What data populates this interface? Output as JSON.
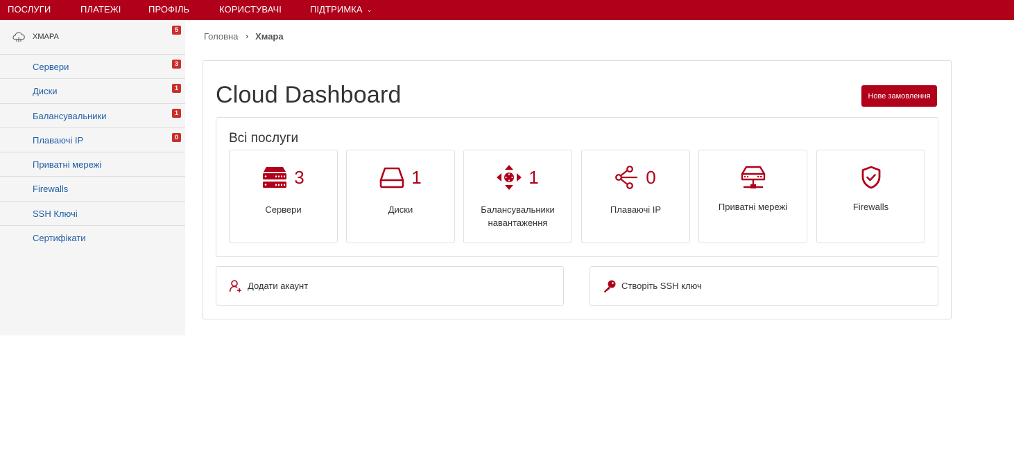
{
  "topnav": {
    "items": [
      {
        "label": "Послуги"
      },
      {
        "label": "Платежі"
      },
      {
        "label": "Профіль"
      },
      {
        "label": "Користувачі"
      },
      {
        "label": "Підтримка"
      }
    ]
  },
  "sidebar": {
    "header": {
      "label": "ХМАРА",
      "badge": "5",
      "icon": "cloud-icon"
    },
    "items": [
      {
        "label": "Сервери",
        "badge": "3"
      },
      {
        "label": "Диски",
        "badge": "1"
      },
      {
        "label": "Балансувальники",
        "badge": "1"
      },
      {
        "label": "Плаваючі IP",
        "badge": "0"
      },
      {
        "label": "Приватні мережі"
      },
      {
        "label": "Firewalls"
      },
      {
        "label": "SSH Ключі"
      },
      {
        "label": "Сертифікати"
      }
    ]
  },
  "breadcrumb": {
    "home": "Головна",
    "current": "Хмара"
  },
  "main": {
    "title": "Cloud Dashboard",
    "new_order_label": "Нове замовлення",
    "services_title": "Всі послуги",
    "tiles": [
      {
        "label": "Сервери",
        "count": "3",
        "icon": "server-icon"
      },
      {
        "label": "Диски",
        "count": "1",
        "icon": "disk-icon"
      },
      {
        "label": "Балансувальники навантаження",
        "count": "1",
        "icon": "load-balancer-icon"
      },
      {
        "label": "Плаваючі IP",
        "count": "0",
        "icon": "floating-ip-icon"
      },
      {
        "label": "Приватні мережі",
        "icon": "private-network-icon"
      },
      {
        "label": "Firewalls",
        "icon": "shield-icon"
      }
    ],
    "actions": [
      {
        "label": "Додати акаунт",
        "icon": "add-user-icon"
      },
      {
        "label": "Створіть SSH ключ",
        "icon": "key-icon"
      }
    ]
  },
  "colors": {
    "brand": "#b0001a",
    "link": "#1f5fa8",
    "badge": "#c9302c"
  }
}
